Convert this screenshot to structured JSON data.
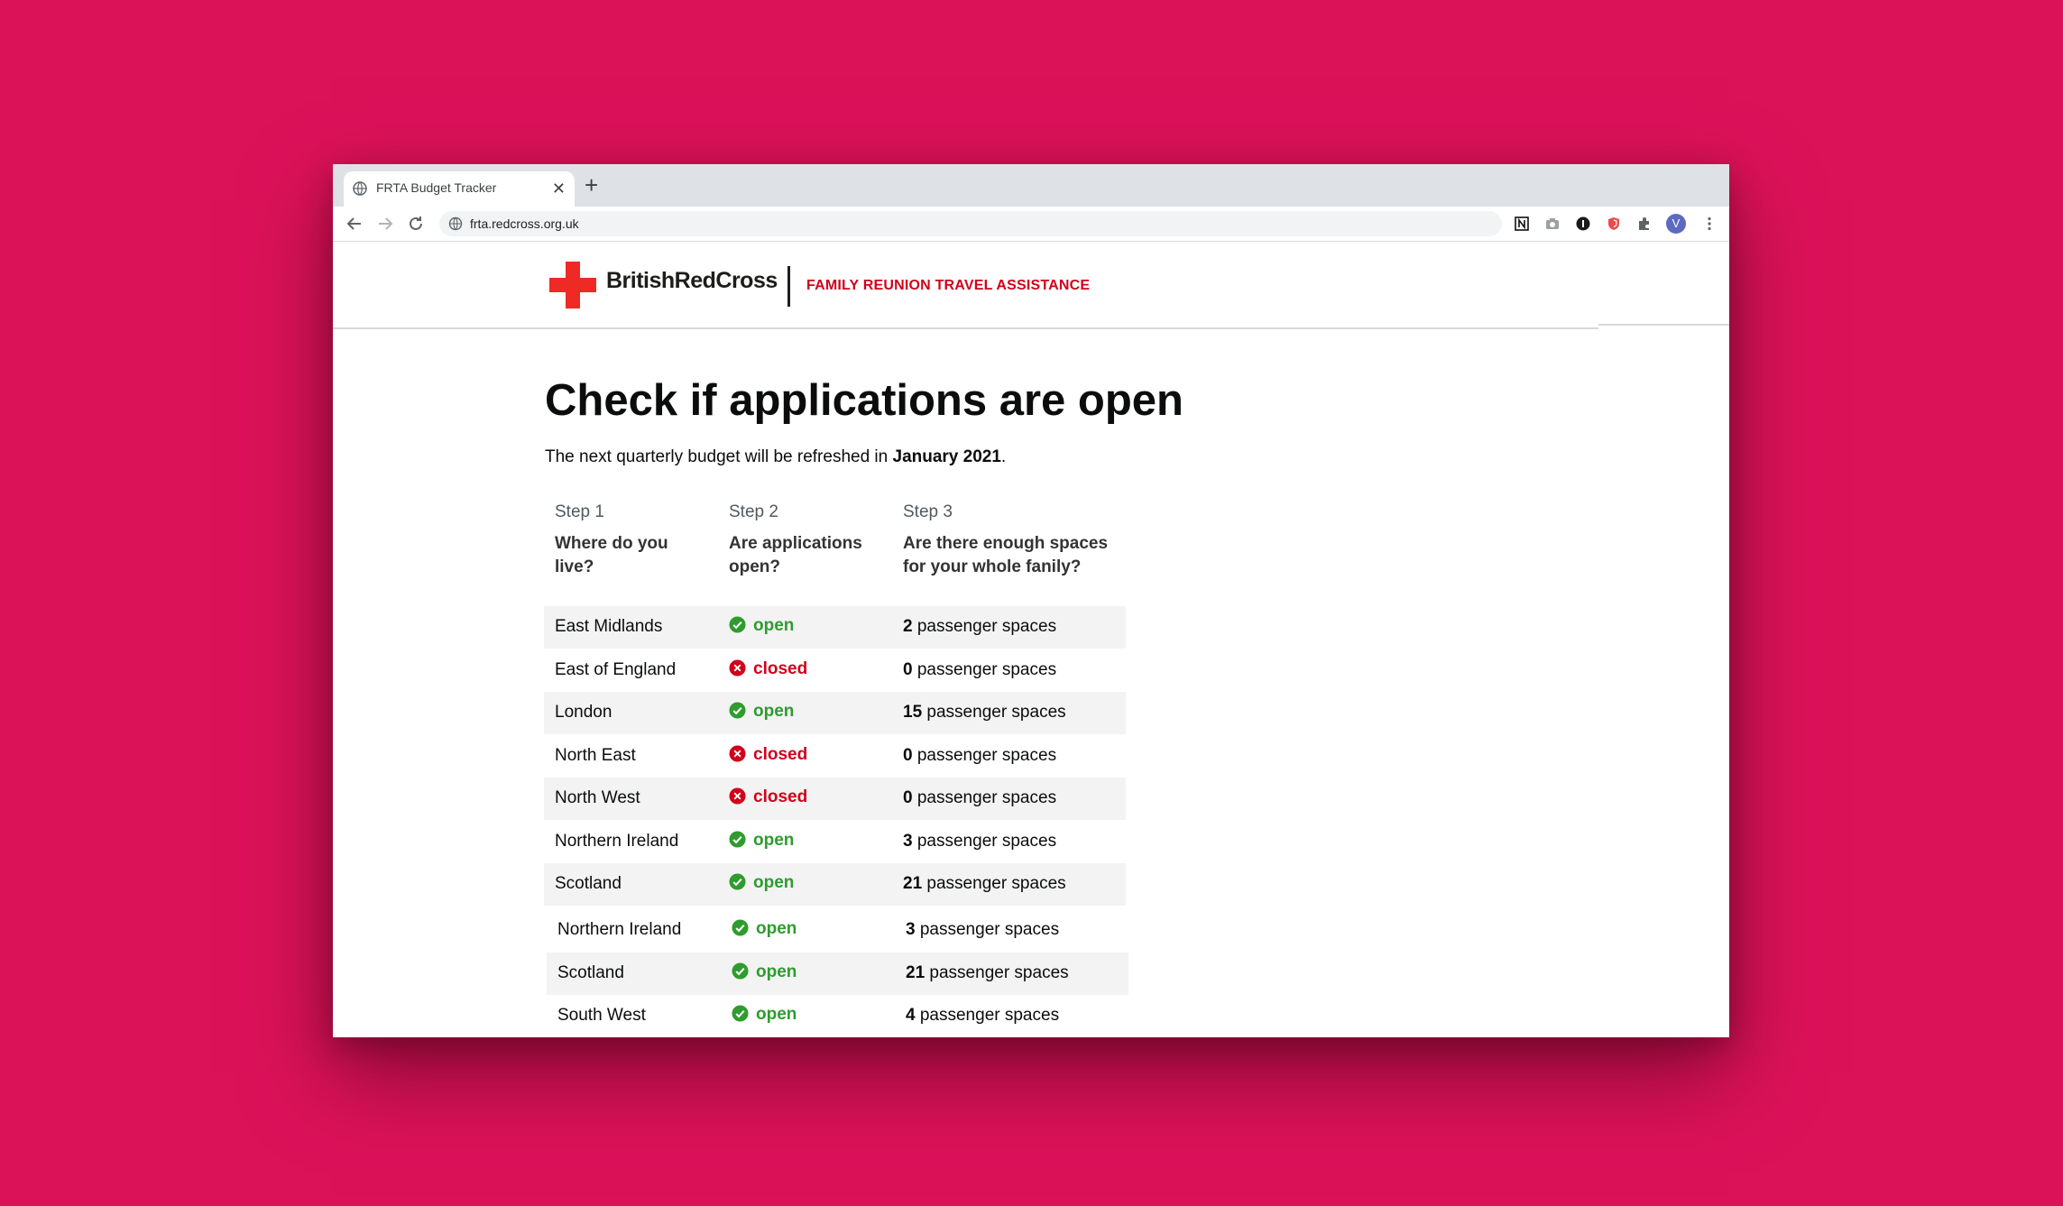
{
  "browser": {
    "tab_title": "FRTA Budget Tracker",
    "tab_close": "✕",
    "new_tab": "+",
    "url": "frta.redcross.org.uk",
    "profile_initial": "V"
  },
  "header": {
    "logo_text": "BritishRedCross",
    "service_name": "FAMILY REUNION TRAVEL ASSISTANCE"
  },
  "main": {
    "title": "Check if applications are open",
    "lead_prefix": "The next quarterly budget will be refreshed in ",
    "lead_date": "January 2021",
    "lead_suffix": "."
  },
  "steps": [
    {
      "num": "Step 1",
      "question": "Where do you live?"
    },
    {
      "num": "Step 2",
      "question": "Are applications open?"
    },
    {
      "num": "Step 3",
      "question": "Are there enough spaces for your whole fanily?"
    }
  ],
  "table": {
    "spaces_suffix": "passenger spaces",
    "rows": [
      {
        "region": "East Midlands",
        "status": "open",
        "spaces": "2"
      },
      {
        "region": "East of England",
        "status": "closed",
        "spaces": "0"
      },
      {
        "region": "London",
        "status": "open",
        "spaces": "15"
      },
      {
        "region": "North East",
        "status": "closed",
        "spaces": "0"
      },
      {
        "region": "North West",
        "status": "closed",
        "spaces": "0"
      },
      {
        "region": "Northern Ireland",
        "status": "open",
        "spaces": "3"
      },
      {
        "region": "Scotland",
        "status": "open",
        "spaces": "21"
      }
    ],
    "overlay_rows": [
      {
        "region": "Northern Ireland",
        "status": "open",
        "spaces": "3"
      },
      {
        "region": "Scotland",
        "status": "open",
        "spaces": "21"
      },
      {
        "region": "South West",
        "status": "open",
        "spaces": "4"
      }
    ]
  },
  "colors": {
    "background": "#dc1259",
    "brand_red": "#d0021b",
    "open_green": "#2e9c2e"
  }
}
